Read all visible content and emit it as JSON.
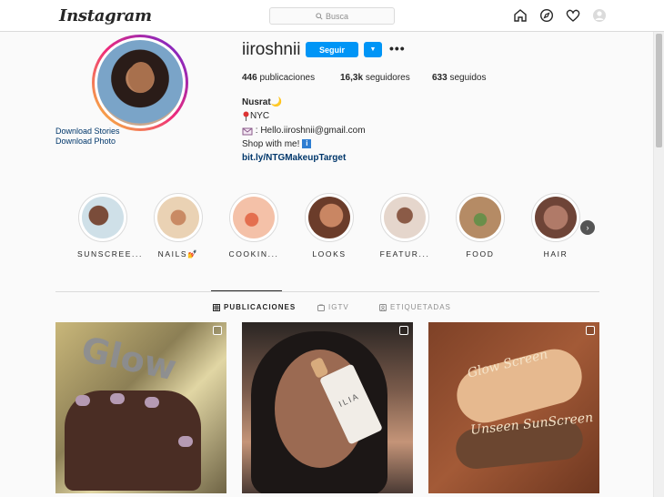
{
  "nav": {
    "logo": "Instagram",
    "search_placeholder": "Busca",
    "icons": [
      "home-icon",
      "explore-icon",
      "heart-icon",
      "profile-avatar-icon"
    ]
  },
  "profile": {
    "username": "iiroshnii",
    "follow_label": "Seguir",
    "download_stories": "Download Stories",
    "download_photo": "Download Photo",
    "stats": {
      "posts_count": "446",
      "posts_label": "publicaciones",
      "followers_count": "16,3k",
      "followers_label": "seguidores",
      "following_count": "633",
      "following_label": "seguidos"
    },
    "bio": {
      "name": "Nusrat🌙",
      "location": "NYC",
      "email": ": Hello.iiroshnii@gmail.com",
      "shop": "Shop with me!",
      "link": "bit.ly/NTGMakeupTarget"
    }
  },
  "highlights": [
    {
      "label": "SUNSCREE...",
      "color": "#c8d6e0"
    },
    {
      "label": "NAILS💅",
      "color": "#e6c4a2"
    },
    {
      "label": "COOKIN...",
      "color": "#f0b39a"
    },
    {
      "label": "LOOKS",
      "color": "#b7774f"
    },
    {
      "label": "FEATUR...",
      "color": "#d8c0b3"
    },
    {
      "label": "FOOD",
      "color": "#a07a57"
    },
    {
      "label": "HAIR",
      "color": "#8b5c4b"
    }
  ],
  "tabs": {
    "posts": "PUBLICACIONES",
    "igtv": "IGTV",
    "tagged": "ETIQUETADAS"
  },
  "posts": {
    "p1_text": "Glow",
    "p2_text": "ILIA",
    "p3_text1": "Glow Screen",
    "p3_text2": "Unseen SunScreen"
  },
  "colors": {
    "accent": "#0095f6",
    "link": "#00376b"
  }
}
